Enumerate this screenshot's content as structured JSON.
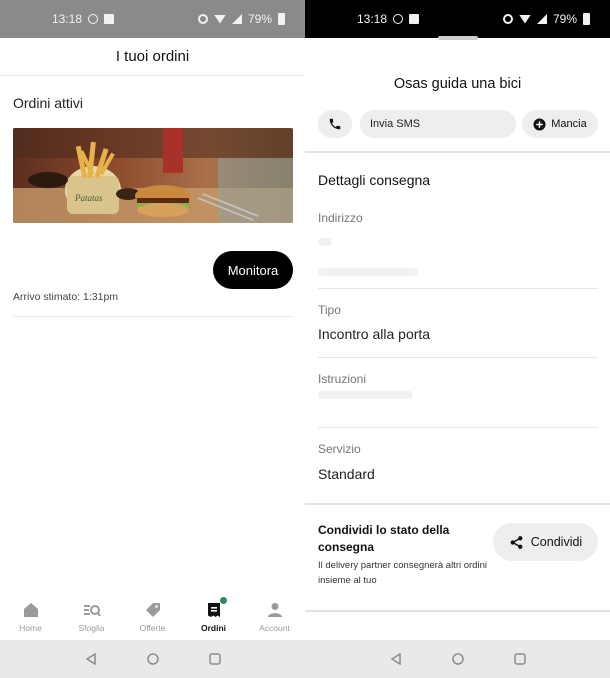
{
  "status_bar": {
    "time": "13:18",
    "battery": "79%"
  },
  "orders_screen": {
    "title": "I tuoi ordini",
    "section_title": "Ordini attivi",
    "monitor_button": "Monitora",
    "eta": "Arrivo stimato: 1:31pm",
    "bottom_nav": [
      {
        "label": "Home",
        "icon": "home-icon"
      },
      {
        "label": "Sfoglia",
        "icon": "browse-icon"
      },
      {
        "label": "Offerte",
        "icon": "tag-icon"
      },
      {
        "label": "Ordini",
        "icon": "receipt-icon",
        "active": true
      },
      {
        "label": "Account",
        "icon": "person-icon"
      }
    ]
  },
  "delivery_screen": {
    "courier_title": "Osas guida una bici",
    "sms_placeholder": "Invia SMS",
    "tip_button": "Mancia",
    "details_title": "Dettagli consegna",
    "fields": {
      "address_label": "Indirizzo",
      "type_label": "Tipo",
      "type_value": "Incontro alla porta",
      "instructions_label": "Istruzioni",
      "service_label": "Servizio",
      "service_value": "Standard"
    },
    "share": {
      "title": "Condividi lo stato della consegna",
      "description": "Il delivery partner consegnerà altri ordini insieme al tuo",
      "button": "Condividi"
    }
  },
  "colors": {
    "primary_button": "#000000",
    "pill_background": "#eeeeee",
    "active_dot": "#2e8b57",
    "left_status_bar": "#8a8a8a"
  }
}
